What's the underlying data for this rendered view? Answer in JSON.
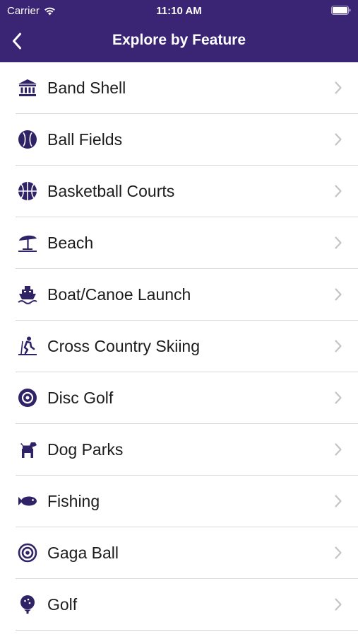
{
  "status_bar": {
    "carrier": "Carrier",
    "time": "11:10 AM"
  },
  "nav": {
    "title": "Explore by Feature"
  },
  "colors": {
    "header": "#3a2474",
    "icon": "#2f2266",
    "chevron": "#c4c4c7"
  },
  "features": [
    {
      "label": "Band Shell",
      "icon": "band-shell-icon"
    },
    {
      "label": "Ball Fields",
      "icon": "baseball-icon"
    },
    {
      "label": "Basketball Courts",
      "icon": "basketball-icon"
    },
    {
      "label": "Beach",
      "icon": "beach-umbrella-icon"
    },
    {
      "label": "Boat/Canoe Launch",
      "icon": "boat-icon"
    },
    {
      "label": "Cross Country Skiing",
      "icon": "skiing-icon"
    },
    {
      "label": "Disc Golf",
      "icon": "disc-icon"
    },
    {
      "label": "Dog Parks",
      "icon": "dog-icon"
    },
    {
      "label": "Fishing",
      "icon": "fish-icon"
    },
    {
      "label": "Gaga Ball",
      "icon": "target-icon"
    },
    {
      "label": "Golf",
      "icon": "golf-ball-icon"
    }
  ]
}
